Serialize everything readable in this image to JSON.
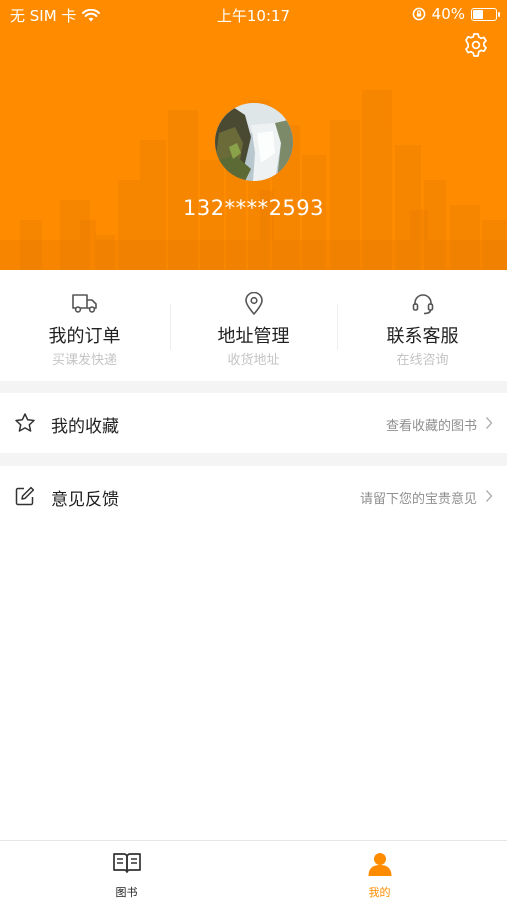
{
  "status_bar": {
    "carrier": "无 SIM 卡",
    "time": "上午10:17",
    "battery_percent": "40%",
    "battery_level": 0.4,
    "icons": [
      "wifi-icon",
      "rotation-lock-icon",
      "battery-icon"
    ]
  },
  "header": {
    "background_color": "#ff8c00",
    "phone": "132****2593",
    "settings_icon": "gear-icon"
  },
  "quick_links": [
    {
      "icon": "truck-icon",
      "title": "我的订单",
      "subtitle": "买课发快递"
    },
    {
      "icon": "location-pin-icon",
      "title": "地址管理",
      "subtitle": "收货地址"
    },
    {
      "icon": "headset-icon",
      "title": "联系客服",
      "subtitle": "在线咨询"
    }
  ],
  "menu": [
    {
      "icon": "star-icon",
      "label": "我的收藏",
      "hint": "查看收藏的图书"
    },
    {
      "icon": "edit-icon",
      "label": "意见反馈",
      "hint": "请留下您的宝贵意见"
    }
  ],
  "tabbar": {
    "active_color": "#ff8c00",
    "tabs": [
      {
        "icon": "book-icon",
        "label": "图书",
        "active": false
      },
      {
        "icon": "person-icon",
        "label": "我的",
        "active": true
      }
    ]
  }
}
